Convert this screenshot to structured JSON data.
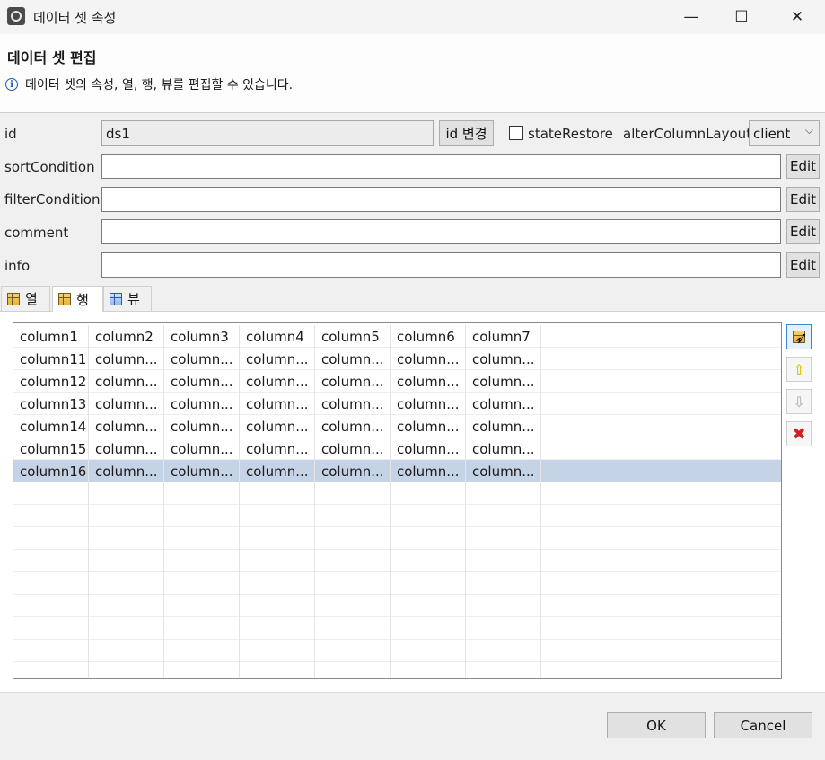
{
  "window": {
    "title": "데이터 셋 속성",
    "minimize": "—",
    "maximize": "☐",
    "close": "✕"
  },
  "header": {
    "heading": "데이터 셋 편집",
    "description": "데이터 셋의 속성, 열, 행, 뷰를 편집할 수 있습니다."
  },
  "form": {
    "id_label": "id",
    "id_value": "ds1",
    "id_change_button": "id 변경",
    "state_restore_label": "stateRestore",
    "state_restore_checked": false,
    "alter_column_layout_label": "alterColumnLayout",
    "alter_column_layout_value": "client",
    "sort_label": "sortCondition",
    "sort_value": "",
    "filter_label": "filterCondition",
    "filter_value": "",
    "comment_label": "comment",
    "comment_value": "",
    "info_label": "info",
    "info_value": "",
    "edit_button": "Edit"
  },
  "tabs": [
    {
      "label": "열",
      "icon": "column-grid-icon"
    },
    {
      "label": "행",
      "icon": "row-grid-icon",
      "active": true
    },
    {
      "label": "뷰",
      "icon": "view-grid-icon"
    }
  ],
  "grid": {
    "header": [
      "column1",
      "column2",
      "column3",
      "column4",
      "column5",
      "column6",
      "column7"
    ],
    "rows": [
      [
        "column11",
        "column...",
        "column...",
        "column...",
        "column...",
        "column...",
        "column..."
      ],
      [
        "column12",
        "column...",
        "column...",
        "column...",
        "column...",
        "column...",
        "column..."
      ],
      [
        "column13",
        "column...",
        "column...",
        "column...",
        "column...",
        "column...",
        "column..."
      ],
      [
        "column14",
        "column...",
        "column...",
        "column...",
        "column...",
        "column...",
        "column..."
      ],
      [
        "column15",
        "column...",
        "column...",
        "column...",
        "column...",
        "column...",
        "column..."
      ],
      [
        "column16",
        "column...",
        "column...",
        "column...",
        "column...",
        "column...",
        "column..."
      ]
    ],
    "selected_row_index": 5
  },
  "side_buttons": {
    "add": "add-row-icon",
    "up": "move-up-icon",
    "down": "move-down-icon",
    "delete": "delete-icon"
  },
  "footer": {
    "ok": "OK",
    "cancel": "Cancel"
  }
}
